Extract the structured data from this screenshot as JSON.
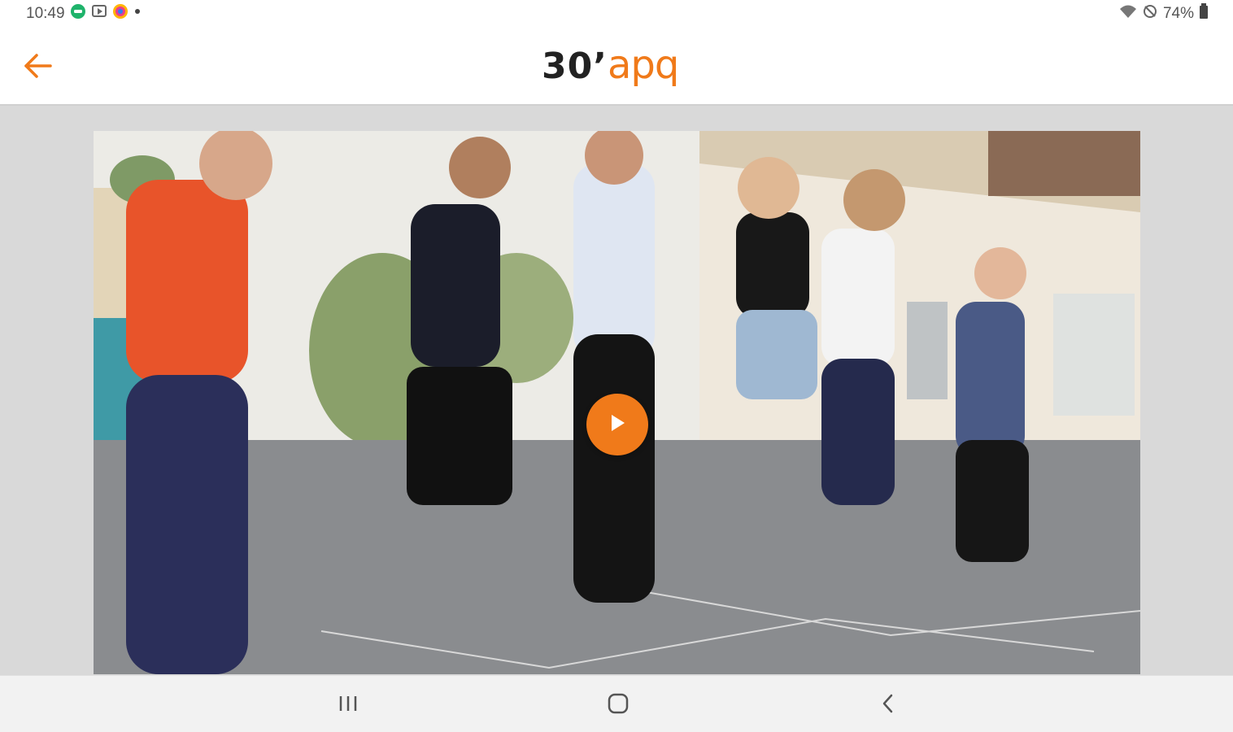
{
  "status_bar": {
    "time": "10:49",
    "battery": "74%",
    "icons": [
      "message-icon",
      "cast-icon",
      "app-icon",
      "dot-icon",
      "wifi-icon",
      "alarm-icon",
      "battery-icon"
    ]
  },
  "header": {
    "back_icon": "arrow-left-icon",
    "logo_part1": "30’",
    "logo_part2": "apq"
  },
  "video": {
    "play_icon": "play-icon",
    "scene": "children hopping in a schoolyard"
  },
  "nav_bar": {
    "icons": [
      "recent-apps-icon",
      "home-icon",
      "back-icon"
    ]
  },
  "colors": {
    "accent": "#f07a1a",
    "header_bg": "#ffffff",
    "content_bg": "#d9d9d9"
  }
}
